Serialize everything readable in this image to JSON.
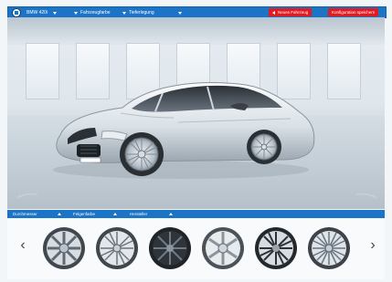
{
  "header": {
    "model_label": "BMW 420i",
    "color_label": "Fahrzeugfarbe",
    "upholstery_label": "Tieferlegung",
    "new_config_label": "Neues Fahrzeug",
    "save_config_label": "Konfiguration speichern"
  },
  "footer": {
    "diameter_label": "Durchmesser",
    "rim_color_label": "Felgenfarbe",
    "manufacturer_label": "Hersteller"
  },
  "wheels": {
    "count": 6,
    "items": [
      "wheel-1",
      "wheel-2",
      "wheel-3",
      "wheel-4",
      "wheel-5",
      "wheel-6"
    ]
  },
  "colors": {
    "brand_blue": "#1b74c6",
    "accent_red": "#e11b22"
  }
}
